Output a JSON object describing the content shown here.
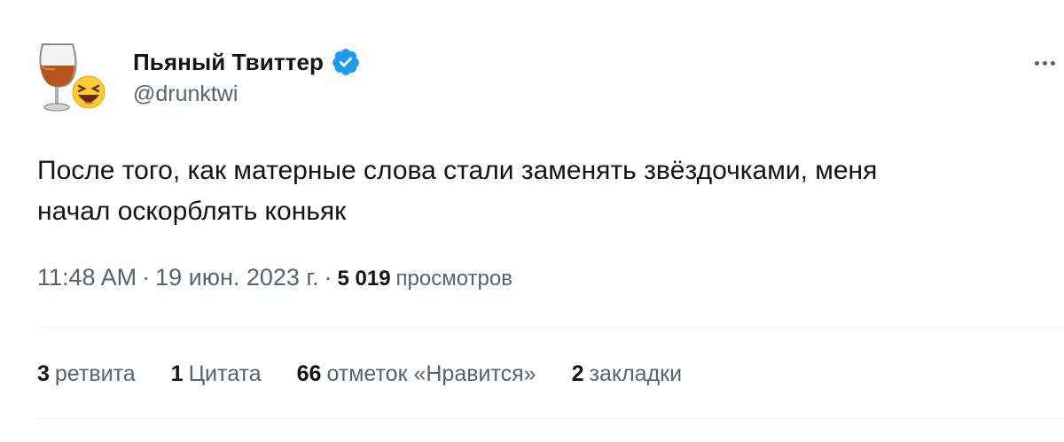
{
  "author": {
    "display_name": "Пьяный Твиттер",
    "handle": "@drunktwi",
    "verified": true,
    "avatar_icon": "cognac-glass-laughing-emoji-icon"
  },
  "tweet": {
    "text_line1": "После того, как матерные слова стали заменять звёздочками, меня",
    "text_line2": "начал оскорблять коньяк"
  },
  "meta": {
    "time": "11:48 AM",
    "separator": "·",
    "date": "19 июн. 2023 г.",
    "views_count": "5 019",
    "views_label": "просмотров"
  },
  "stats": [
    {
      "count": "3",
      "label": "ретвита"
    },
    {
      "count": "1",
      "label": "Цитата"
    },
    {
      "count": "66",
      "label": "отметок «Нравится»"
    },
    {
      "count": "2",
      "label": "закладки"
    }
  ],
  "colors": {
    "verified_blue": "#1d9bf0",
    "secondary_text": "#536471",
    "primary_text": "#0f1419"
  }
}
